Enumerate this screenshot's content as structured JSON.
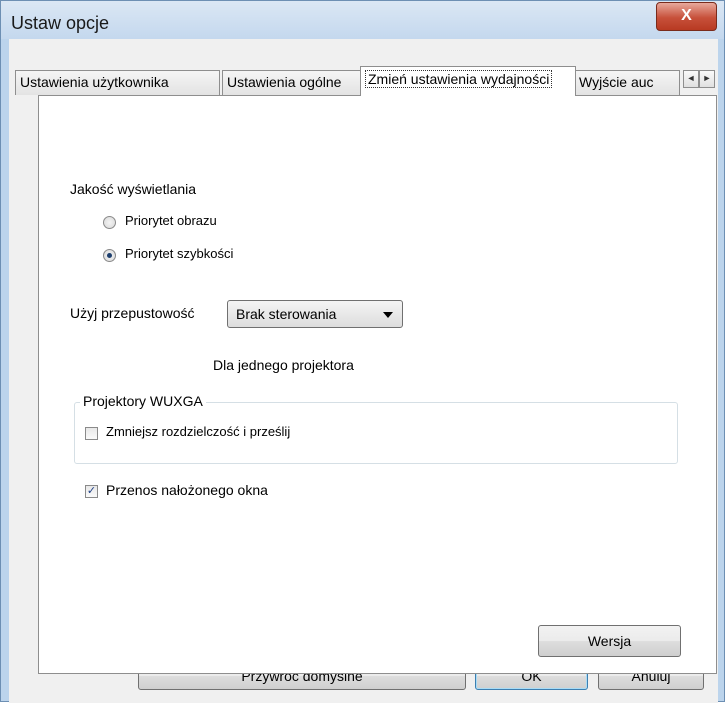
{
  "window": {
    "title": "Ustaw opcje",
    "close_label": "X"
  },
  "tabs": [
    {
      "label": "Ustawienia użytkownika"
    },
    {
      "label": "Ustawienia ogólne"
    },
    {
      "label": "Zmień ustawienia wydajności",
      "active": true
    },
    {
      "label": "Wyjście auc"
    }
  ],
  "tab_scroll": {
    "left": "◄",
    "right": "►"
  },
  "display_quality": {
    "label": "Jakość wyświetlania",
    "options": [
      {
        "label": "Priorytet obrazu",
        "selected": false
      },
      {
        "label": "Priorytet szybkości",
        "selected": true
      }
    ]
  },
  "bandwidth": {
    "label": "Użyj przepustowość",
    "value": "Brak sterowania",
    "note": "Dla jednego projektora"
  },
  "wuxga": {
    "group_label": "Projektory WUXGA",
    "checkbox_label": "Zmniejsz rozdzielczość i prześlij",
    "checked": false
  },
  "overlay": {
    "label": "Przenos nałożonego okna",
    "checked": true
  },
  "buttons": {
    "version": "Wersja",
    "restore": "Przywróć domyślne",
    "ok": "OK",
    "cancel": "Anuluj"
  }
}
